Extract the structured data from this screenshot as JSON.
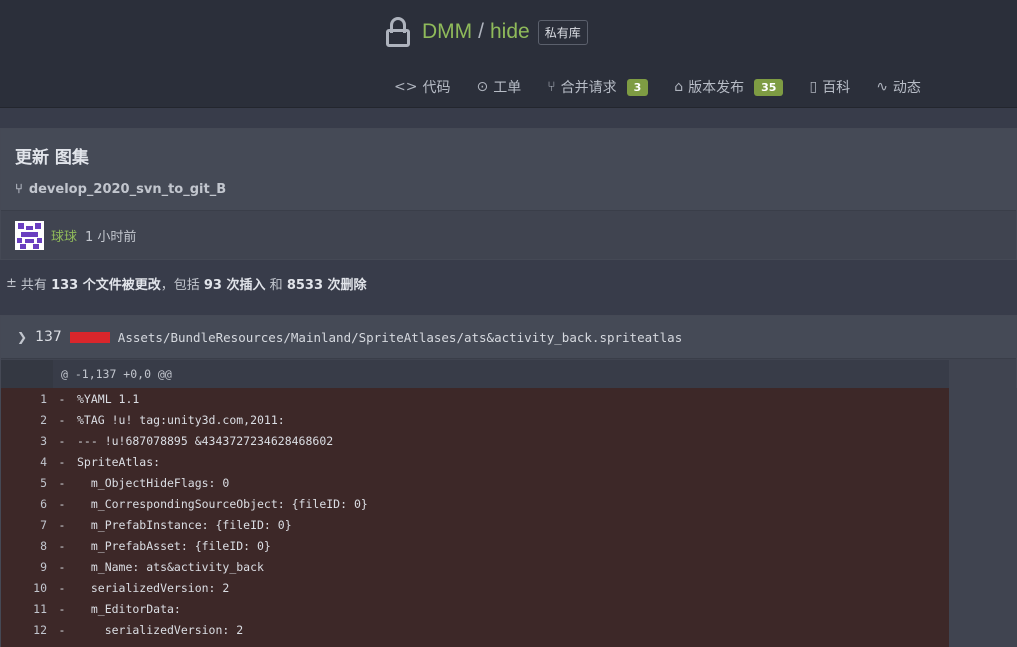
{
  "repo": {
    "owner": "DMM",
    "separator": "/",
    "name": "hide",
    "visibility": "私有库"
  },
  "nav": {
    "code": {
      "icon": "code-icon",
      "label": "代码"
    },
    "issues": {
      "icon": "issue-icon",
      "label": "工单"
    },
    "pulls": {
      "icon": "pull-request-icon",
      "label": "合并请求",
      "count": "3"
    },
    "releases": {
      "icon": "tag-icon",
      "label": "版本发布",
      "count": "35"
    },
    "wiki": {
      "icon": "book-icon",
      "label": "百科"
    },
    "activity": {
      "icon": "pulse-icon",
      "label": "动态"
    }
  },
  "commit": {
    "title": "更新 图集",
    "branch": "develop_2020_svn_to_git_B",
    "author": "球球",
    "time": "1 小时前"
  },
  "stats": {
    "prefix": "共有",
    "files": "133 个文件被更改",
    "mid": "，包括",
    "insertions": "93 次插入",
    "and": "和",
    "deletions": "8533 次删除"
  },
  "file": {
    "changes": "137",
    "path": "Assets/BundleResources/Mainland/SpriteAtlases/ats&activity_back.spriteatlas",
    "hunk": "@ -1,137 +0,0 @@",
    "lines": [
      {
        "n": "1",
        "m": "-",
        "c": "%YAML 1.1"
      },
      {
        "n": "2",
        "m": "-",
        "c": "%TAG !u! tag:unity3d.com,2011:"
      },
      {
        "n": "3",
        "m": "-",
        "c": "--- !u!687078895 &4343727234628468602"
      },
      {
        "n": "4",
        "m": "-",
        "c": "SpriteAtlas:"
      },
      {
        "n": "5",
        "m": "-",
        "c": "  m_ObjectHideFlags: 0"
      },
      {
        "n": "6",
        "m": "-",
        "c": "  m_CorrespondingSourceObject: {fileID: 0}"
      },
      {
        "n": "7",
        "m": "-",
        "c": "  m_PrefabInstance: {fileID: 0}"
      },
      {
        "n": "8",
        "m": "-",
        "c": "  m_PrefabAsset: {fileID: 0}"
      },
      {
        "n": "9",
        "m": "-",
        "c": "  m_Name: ats&activity_back"
      },
      {
        "n": "10",
        "m": "-",
        "c": "  serializedVersion: 2"
      },
      {
        "n": "11",
        "m": "-",
        "c": "  m_EditorData:"
      },
      {
        "n": "12",
        "m": "-",
        "c": "    serializedVersion: 2"
      }
    ]
  }
}
